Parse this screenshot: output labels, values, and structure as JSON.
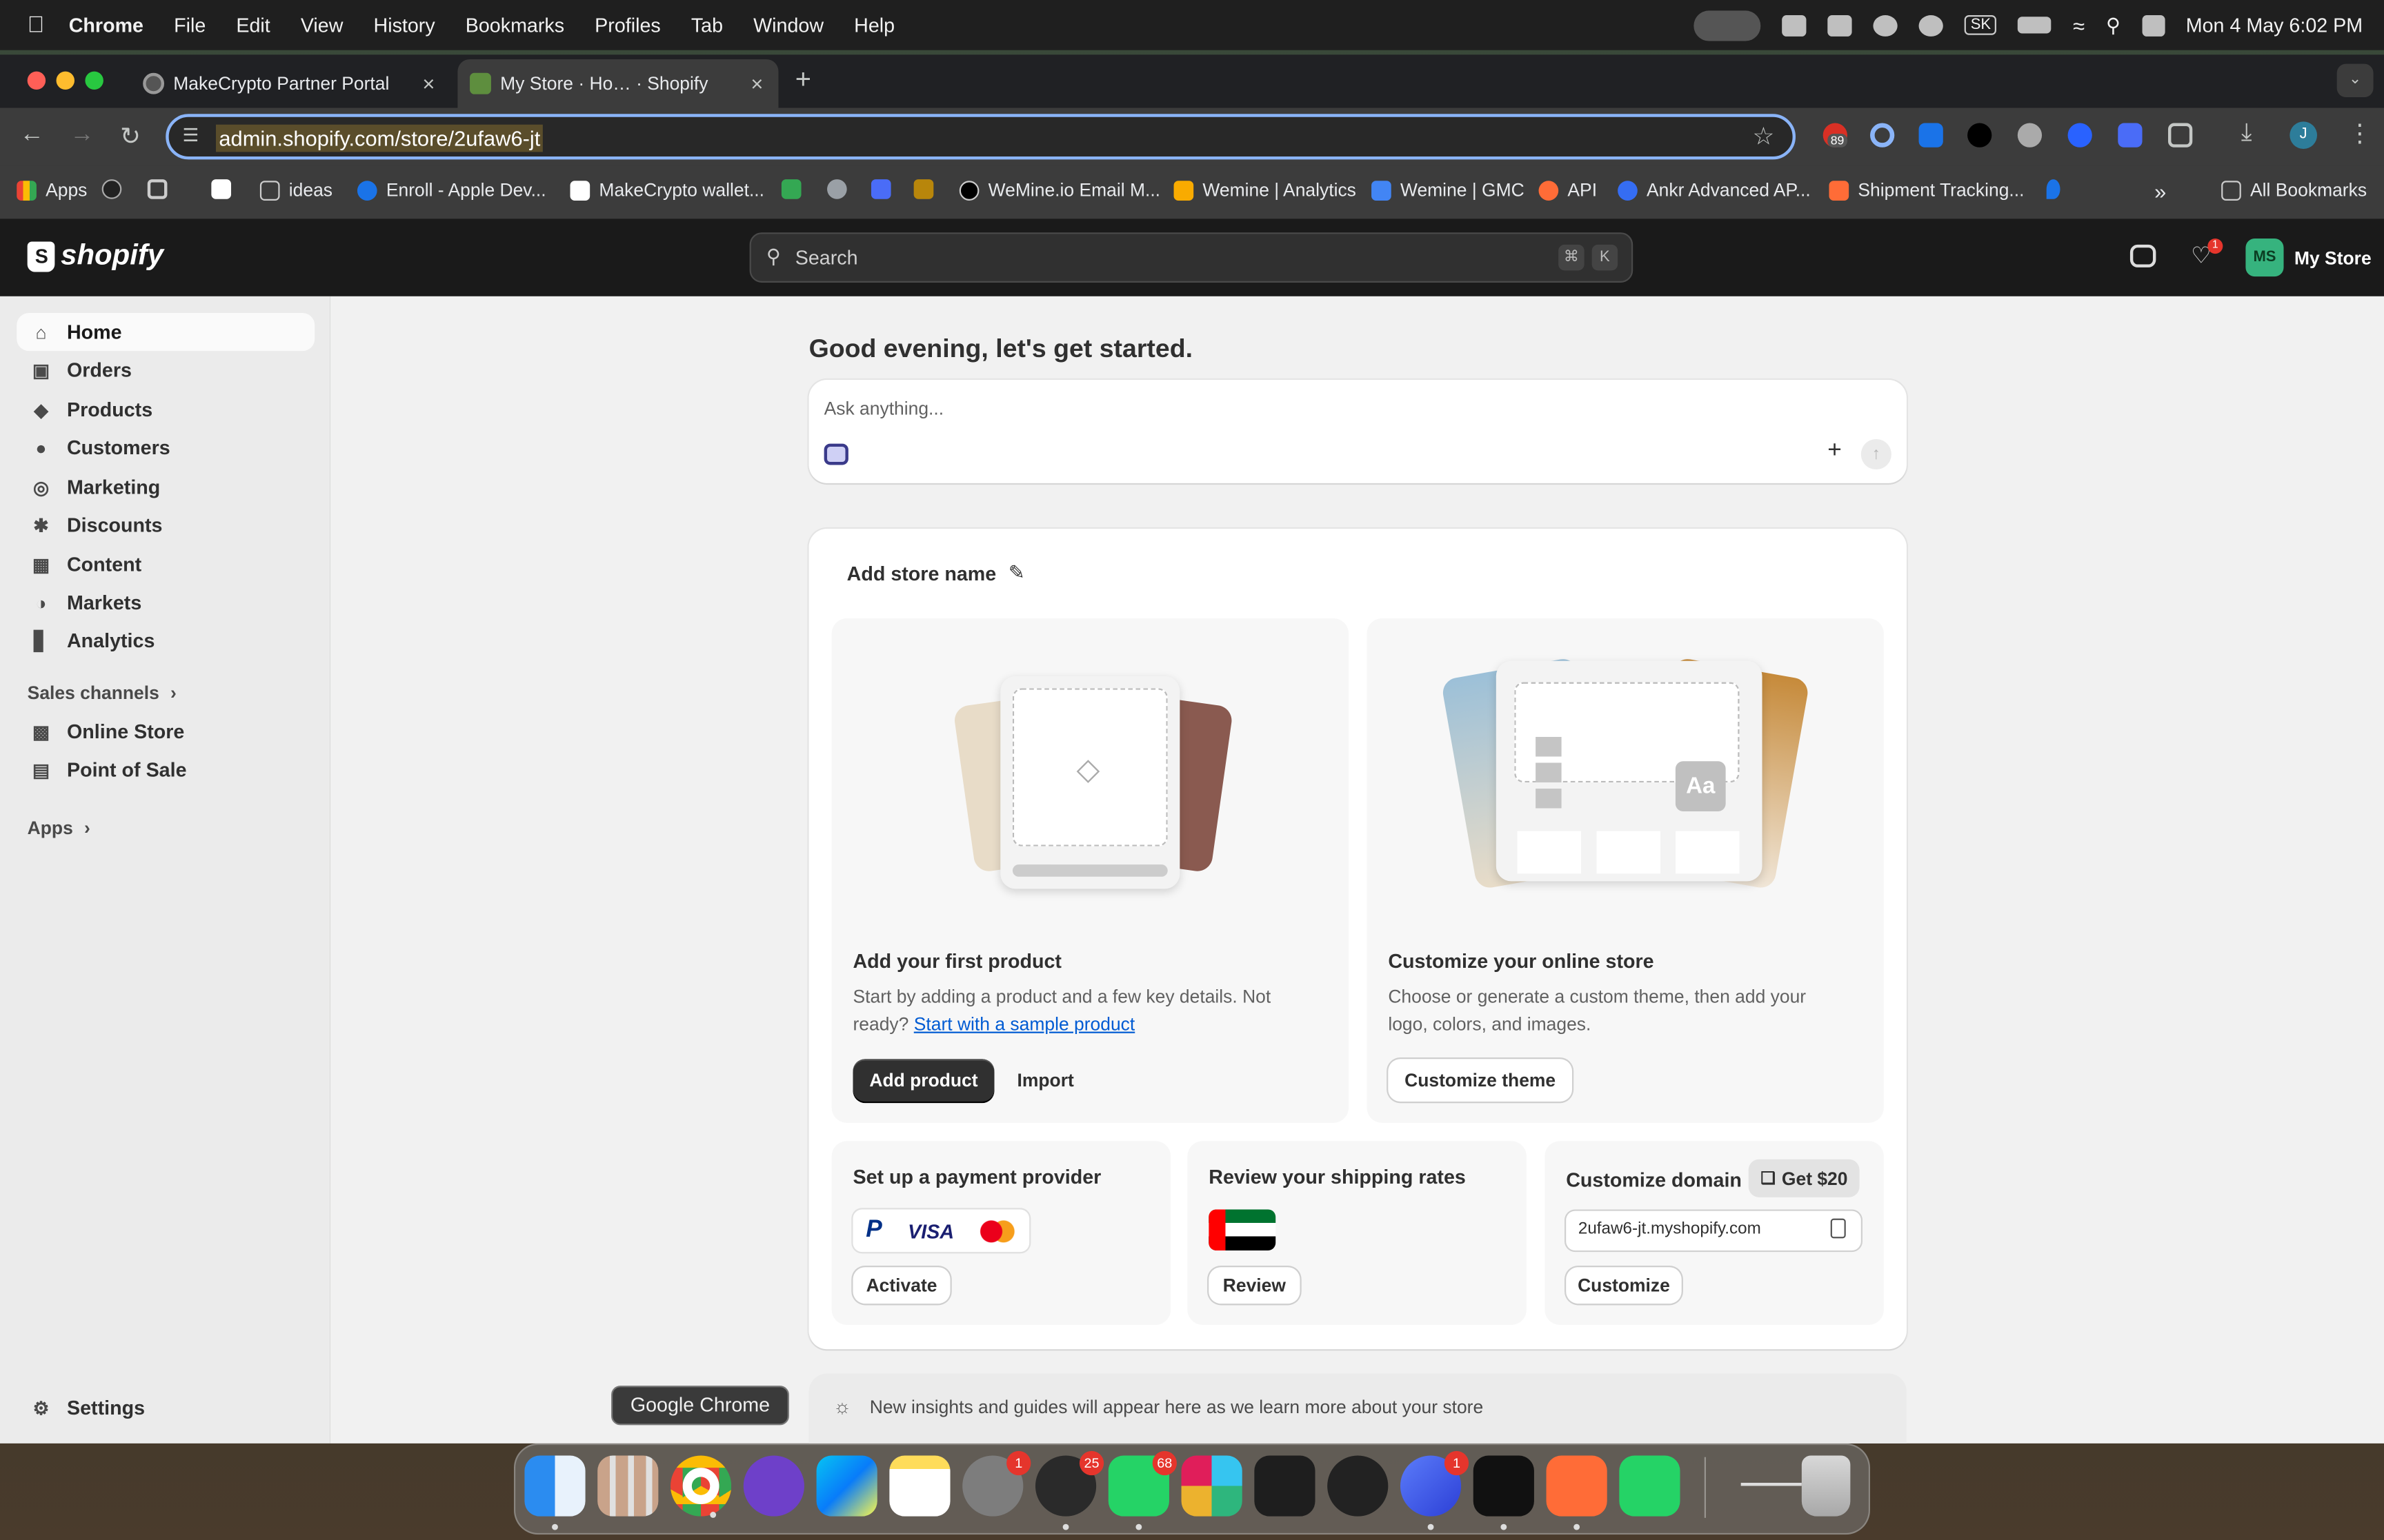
{
  "menubar": {
    "app": "Chrome",
    "items": [
      "File",
      "Edit",
      "View",
      "History",
      "Bookmarks",
      "Profiles",
      "Tab",
      "Window",
      "Help"
    ],
    "datetime": "Mon 4 May  6:02 PM",
    "sk_label": "SK"
  },
  "browser": {
    "tabs": [
      {
        "title": "MakeCrypto Partner Portal"
      },
      {
        "title": "My Store · Ho… · Shopify"
      }
    ],
    "url": "admin.shopify.com/store/2ufaw6-jt",
    "ext_badge": "89",
    "profile_initial": "J",
    "bookmarks": [
      {
        "label": "Apps"
      },
      {
        "label": "ideas"
      },
      {
        "label": "Enroll - Apple Dev..."
      },
      {
        "label": "MakeCrypto wallet..."
      },
      {
        "label": "WeMine.io Email M..."
      },
      {
        "label": "Wemine | Analytics"
      },
      {
        "label": "Wemine | GMC"
      },
      {
        "label": "API"
      },
      {
        "label": "Ankr Advanced AP..."
      },
      {
        "label": "Shipment Tracking..."
      }
    ],
    "all_bookmarks": "All Bookmarks"
  },
  "shopify": {
    "logo": "shopify",
    "search_placeholder": "Search",
    "kbd_cmd": "⌘",
    "kbd_k": "K",
    "notif_count": "1",
    "store_initials": "MS",
    "store_name": "My Store"
  },
  "sidebar": {
    "items": [
      {
        "label": "Home",
        "icon": "home-icon"
      },
      {
        "label": "Orders",
        "icon": "inbox-icon"
      },
      {
        "label": "Products",
        "icon": "tag-icon"
      },
      {
        "label": "Customers",
        "icon": "person-icon"
      },
      {
        "label": "Marketing",
        "icon": "target-icon"
      },
      {
        "label": "Discounts",
        "icon": "discount-icon"
      },
      {
        "label": "Content",
        "icon": "image-icon"
      },
      {
        "label": "Markets",
        "icon": "globe-icon"
      },
      {
        "label": "Analytics",
        "icon": "bar-chart-icon"
      }
    ],
    "sales_channels": "Sales channels",
    "channels": [
      {
        "label": "Online Store",
        "icon": "store-icon"
      },
      {
        "label": "Point of Sale",
        "icon": "pos-icon"
      }
    ],
    "apps": "Apps",
    "settings": "Settings"
  },
  "main": {
    "greeting": "Good evening, let's get started.",
    "ask_placeholder": "Ask anything...",
    "store_name_prompt": "Add store name",
    "product": {
      "title": "Add your first product",
      "desc_1": "Start by adding a product and a few key details. Not",
      "desc_2": "ready?",
      "link": "Start with a sample product",
      "primary": "Add product",
      "secondary": "Import"
    },
    "theme": {
      "title": "Customize your online store",
      "desc_1": "Choose or generate a custom theme, then add your",
      "desc_2": "logo, colors, and images.",
      "button": "Customize theme",
      "aa": "Aa"
    },
    "payment": {
      "title": "Set up a payment provider",
      "button": "Activate",
      "visa": "VISA",
      "paypal": "P"
    },
    "shipping": {
      "title": "Review your shipping rates",
      "button": "Review"
    },
    "domain": {
      "title": "Customize domain",
      "badge": "Get $20",
      "value": "2ufaw6-jt.myshopify.com",
      "button": "Customize"
    },
    "insights": "New insights and guides will appear here as we learn more about your store"
  },
  "dock": {
    "tooltip": "Google Chrome",
    "badges": {
      "settings": "1",
      "telegram": "25",
      "whatsapp": "68",
      "messenger": "1"
    }
  },
  "colors": {
    "accent_green": "#36b37e",
    "primary_button": "#303030",
    "link": "#005bd3",
    "badge_red": "#e5352c"
  }
}
